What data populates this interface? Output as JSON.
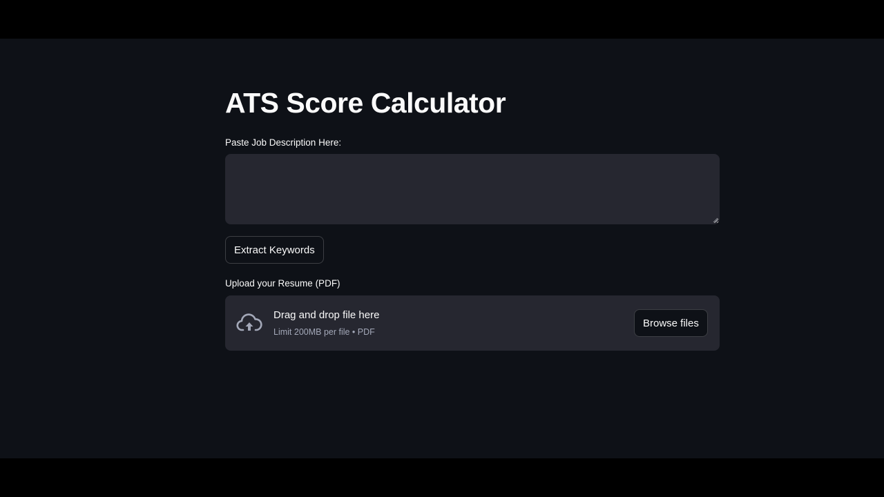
{
  "page": {
    "title": "ATS Score Calculator"
  },
  "job_description": {
    "label": "Paste Job Description Here:",
    "value": "",
    "placeholder": ""
  },
  "extract_button": {
    "label": "Extract Keywords"
  },
  "resume_upload": {
    "label": "Upload your Resume (PDF)",
    "drop_text": "Drag and drop file here",
    "limit_text": "Limit 200MB per file • PDF",
    "browse_label": "Browse files",
    "icon": "cloud-upload-icon"
  },
  "colors": {
    "background": "#0e1117",
    "surface": "#262730",
    "text": "#fafafa",
    "muted_text": "#a3a8b8"
  }
}
